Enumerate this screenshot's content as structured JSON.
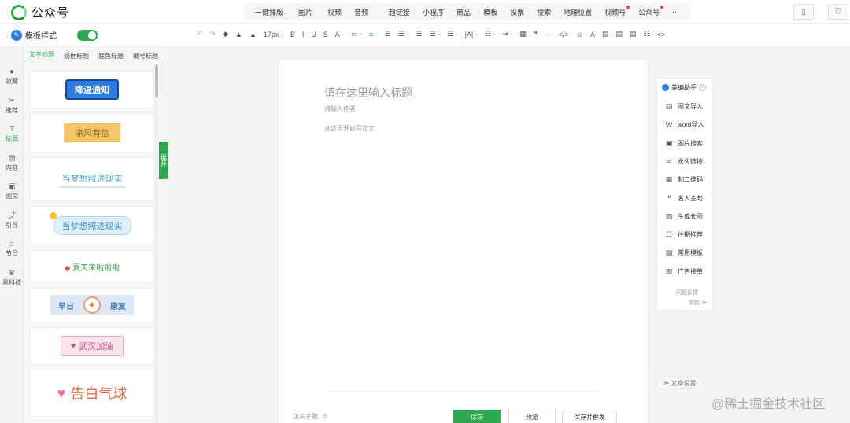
{
  "brand": {
    "name": "公众号"
  },
  "menu": {
    "group1": [
      {
        "label": "一键排版·",
        "dot": false
      },
      {
        "label": "图片·",
        "dot": false
      },
      {
        "label": "视频",
        "dot": false
      },
      {
        "label": "音频",
        "dot": false
      }
    ],
    "group2": [
      {
        "label": "超链接",
        "dot": false
      },
      {
        "label": "小程序",
        "dot": false
      },
      {
        "label": "商品",
        "dot": false
      },
      {
        "label": "模板",
        "dot": false
      },
      {
        "label": "投票",
        "dot": false
      },
      {
        "label": "搜索",
        "dot": false
      },
      {
        "label": "地理位置",
        "dot": false
      },
      {
        "label": "视频号",
        "dot": true
      },
      {
        "label": "公众号",
        "dot": true
      },
      {
        "label": "···",
        "dot": false
      }
    ]
  },
  "toolbar": {
    "template_style": "模板样式",
    "template_toggle_on": true,
    "font_size": "17px",
    "tools": [
      "↶",
      "↷",
      "◆",
      "▲",
      "▲",
      "17px ·",
      "B",
      "I",
      "U",
      "S",
      "A ·",
      "▭ ·",
      "≡ ·",
      "☰",
      "☰ ·",
      "☰",
      "☰ ·",
      "☰ ·",
      "|A| ·",
      "☷ ·",
      "⇥ ·",
      "▦",
      "❝",
      "—",
      "</>",
      "☺",
      "A",
      "▤",
      "▤",
      "▤",
      "☷",
      "<>"
    ]
  },
  "rail": [
    {
      "label": "收藏",
      "icon": "user-icon",
      "glyph": "●",
      "active": false
    },
    {
      "label": "推荐",
      "icon": "magic-icon",
      "glyph": "✂",
      "active": false
    },
    {
      "label": "标题",
      "icon": "title-icon",
      "glyph": "T",
      "active": true
    },
    {
      "label": "内容",
      "icon": "content-icon",
      "glyph": "▤",
      "active": false
    },
    {
      "label": "图文",
      "icon": "image-icon",
      "glyph": "▣",
      "active": false
    },
    {
      "label": "引导",
      "icon": "guide-icon",
      "glyph": "⤴",
      "active": false
    },
    {
      "label": "节日",
      "icon": "festival-icon",
      "glyph": "⌂",
      "active": false
    },
    {
      "label": "黑科技",
      "icon": "tech-icon",
      "glyph": "♛",
      "active": false
    }
  ],
  "panel": {
    "tabs": [
      "文字标题",
      "线框标题",
      "底色标题",
      "编号标题"
    ],
    "active_tab": 0,
    "expand_label": "展开",
    "cards": [
      {
        "text": "降温通知"
      },
      {
        "text": "凉风有信"
      },
      {
        "text": "当梦想照进现实"
      },
      {
        "text": "当梦想照进现实"
      },
      {
        "text": "夏天来啦啦啦"
      },
      {
        "left": "早日",
        "mid": "✚",
        "right": "康复"
      },
      {
        "text": "武汉加油"
      },
      {
        "text": "告白气球"
      }
    ]
  },
  "editor": {
    "title_placeholder": "请在这里输入标题",
    "author_placeholder": "请输入作者",
    "body_placeholder": "从这里开始写正文"
  },
  "footer": {
    "word_count_label": "正文字数",
    "word_count": "0",
    "save": "保存",
    "preview": "预览",
    "save_send": "保存并群发"
  },
  "helper": {
    "title": "美编助手",
    "items": [
      {
        "label": "图文导入",
        "icon": "doc-import-icon",
        "glyph": "▤"
      },
      {
        "label": "word导入",
        "icon": "word-import-icon",
        "glyph": "W"
      },
      {
        "label": "图片搜索",
        "icon": "image-search-icon",
        "glyph": "▣"
      },
      {
        "label": "永久链接",
        "icon": "link-icon",
        "glyph": "∞"
      },
      {
        "label": "制二维码",
        "icon": "qrcode-icon",
        "glyph": "▦"
      },
      {
        "label": "名人金句",
        "icon": "quote-icon",
        "glyph": "❝"
      },
      {
        "label": "生成长图",
        "icon": "long-image-icon",
        "glyph": "▨"
      },
      {
        "label": "往期推荐",
        "icon": "history-icon",
        "glyph": "☷"
      },
      {
        "label": "常用模板",
        "icon": "template-icon",
        "glyph": "▤"
      },
      {
        "label": "广告接单",
        "icon": "ad-icon",
        "glyph": "▥"
      }
    ],
    "feedback": "问题反馈",
    "collapse": "收起 ≫"
  },
  "article_settings": "≫ 文章设置",
  "watermark": "@稀土掘金技术社区",
  "colors": {
    "accent": "#2fa84f",
    "blue": "#2f7fe0"
  }
}
